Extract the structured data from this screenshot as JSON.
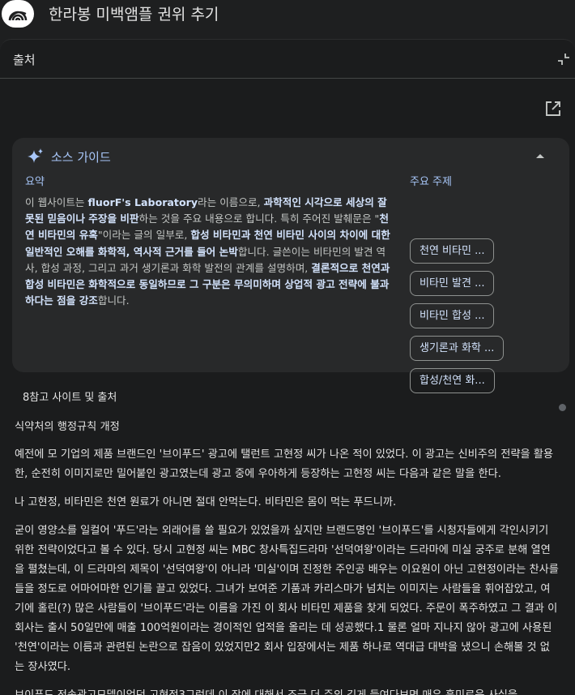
{
  "notebook": {
    "title": "한라봉 미백앰플 권위 추기"
  },
  "panel": {
    "title": "출처"
  },
  "guide": {
    "title": "소스 가이드",
    "summary_label": "요약",
    "topics_label": "주요 주제",
    "summary_segments": [
      {
        "text": "이 웹사이트는 ",
        "bold": false
      },
      {
        "text": "fluorF's Laboratory",
        "bold": true
      },
      {
        "text": "라는 이름으로, ",
        "bold": false
      },
      {
        "text": "과학적인 시각으로 세상의 잘못된 믿음이나 주장을 비판",
        "bold": true
      },
      {
        "text": "하는 것을 주요 내용으로 합니다. 특히 주어진 발췌문은 \"",
        "bold": false
      },
      {
        "text": "천연 비타민의 유혹",
        "bold": true
      },
      {
        "text": "\"이라는 글의 일부로, ",
        "bold": false
      },
      {
        "text": "합성 비타민과 천연 비타민 사이의 차이에 대한 일반적인 오해를 화학적, 역사적 근거를 들어 논박",
        "bold": true
      },
      {
        "text": "합니다. 글쓴이는 비타민의 발견 역사, 합성 과정, 그리고 과거 생기론과 화학 발전의 관계를 설명하며, ",
        "bold": false
      },
      {
        "text": "결론적으로 천연과 합성 비타민은 화학적으로 동일하므로 그 구분은 무의미하며 상업적 광고 전략에 불과하다는 점을 강조",
        "bold": true
      },
      {
        "text": "합니다.",
        "bold": false
      }
    ],
    "topics": [
      "천연 비타민 ...",
      "비타민 발견 ...",
      "비타민 합성 ...",
      "생기론과 화학 ...",
      "합성/천연 화..."
    ]
  },
  "references": {
    "label": "8참고 사이트 및 출처"
  },
  "source": {
    "heading": "식약처의 행정규칙 개정",
    "p1": "예전에 모 기업의 제품 브랜드인 '브이푸드' 광고에 탤런트 고현정 씨가 나온 적이 있었다. 이 광고는 신비주의 전략을 활용한, 순전히 이미지로만 밀어붙인 광고였는데 광고 중에 우아하게 등장하는 고현정 씨는 다음과 같은 말을 한다.",
    "p2": "나 고현정, 비타민은 천연 원료가 아니면 절대 안먹는다. 비타민은 몸이 먹는 푸드니까.",
    "p3": "굳이 영양소를 일컬어 '푸드'라는 외래어를 쓸 필요가 있었을까 싶지만 브랜드명인 '브이푸드'를 시청자들에게 각인시키기 위한 전략이었다고 볼 수 있다. 당시 고현정 씨는 MBC 창사특집드라마 '선덕여왕'이라는 드라마에 미실 궁주로 분해 열연을 펼쳤는데, 이 드라마의 제목이 '선덕여왕'이 아니라 '미실'이며 진정한 주인공 배우는 이요원이 아닌 고현정이라는 찬사를 들을 정도로 어마어마한 인기를 끌고 있었다. 그녀가 보여준 기품과 카리스마가 넘치는 이미지는 사람들을 휘어잡았고, 여기에 홀린(?) 많은 사람들이 '브이푸드'라는 이름을 가진 이 회사 비타민 제품을 찾게 되었다. 주문이 폭주하였고 그 결과 이 회사는 출시 50일만에 매출 100억원이라는 경이적인 업적을 올리는 데 성공했다.1 물론 얼마 지나지 않아 광고에 사용된 '천연'이라는 이름과 관련된 논란으로 잡음이 있었지만2 회사 입장에서는 제품 하나로 역대급 대박을 냈으니 손해볼 것 없는 장사였다.",
    "p4": "브이푸드 전속광고모델이었던 고현정3그런데 이 장에 대해서 조금 더 주의 깊게 들여다보면 매우 흥미로운 사실을"
  }
}
